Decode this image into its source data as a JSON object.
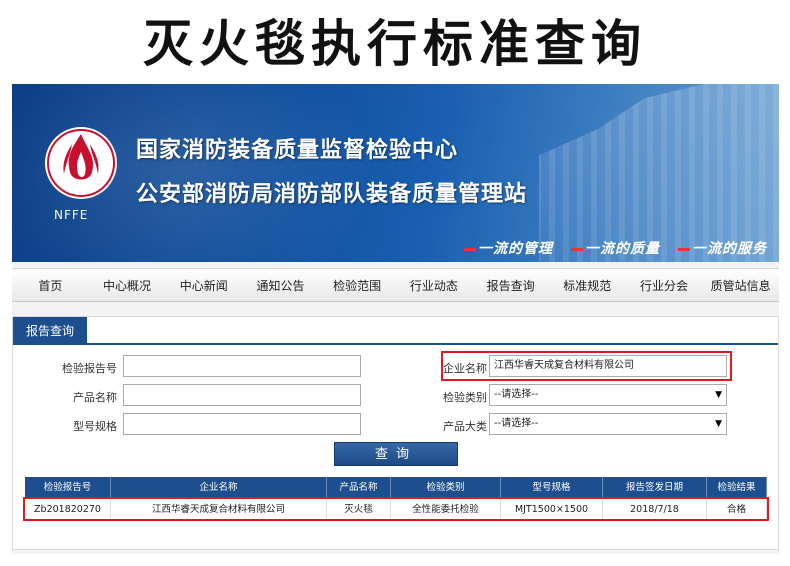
{
  "page_title": "灭火毯执行标准查询",
  "banner": {
    "logo_text": "NFFE",
    "line1": "国家消防装备质量监督检验中心",
    "line2": "公安部消防局消防部队装备质量管理站",
    "slogans": [
      "一流的管理",
      "一流的质量",
      "一流的服务"
    ],
    "colors": {
      "primary": "#11509f",
      "accent": "#e0191f"
    }
  },
  "nav": {
    "items": [
      "首页",
      "中心概况",
      "中心新闻",
      "通知公告",
      "检验范围",
      "行业动态",
      "报告查询",
      "标准规范",
      "行业分会",
      "质管站信息"
    ]
  },
  "report_query": {
    "tab_label": "报告查询",
    "fields": {
      "report_no": {
        "label": "检验报告号",
        "value": ""
      },
      "product_name": {
        "label": "产品名称",
        "value": ""
      },
      "model_spec": {
        "label": "型号规格",
        "value": ""
      },
      "company_name": {
        "label": "企业名称",
        "value": "江西华睿天成复合材料有限公司"
      },
      "test_type": {
        "label": "检验类别",
        "value": "--请选择--"
      },
      "product_category": {
        "label": "产品大类",
        "value": "--请选择--"
      }
    },
    "query_button": "查询"
  },
  "results": {
    "columns": [
      "检验报告号",
      "企业名称",
      "产品名称",
      "检验类别",
      "型号规格",
      "报告签发日期",
      "检验结果"
    ],
    "rows": [
      [
        "Zb201820270",
        "江西华睿天成复合材料有限公司",
        "灭火毯",
        "全性能委托检验",
        "MJT1500×1500",
        "2018/7/18",
        "合格"
      ]
    ]
  }
}
